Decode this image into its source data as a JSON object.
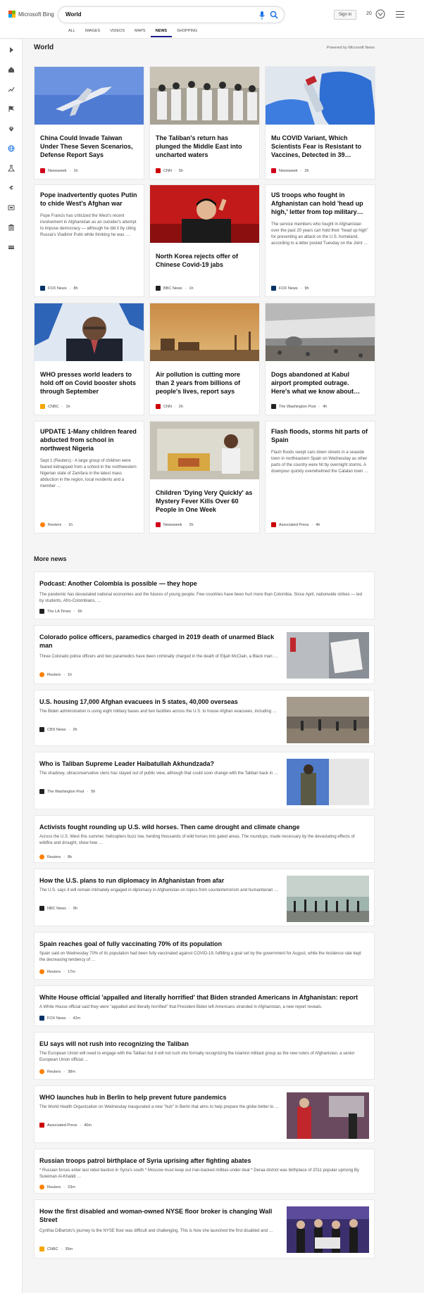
{
  "header": {
    "brand": "Microsoft Bing",
    "query": "World",
    "signin": "Sign in",
    "points": "20",
    "tabs": [
      "ALL",
      "IMAGES",
      "VIDEOS",
      "MAPS",
      "NEWS",
      "SHOPPING"
    ],
    "active_tab": "NEWS"
  },
  "section": {
    "title": "World",
    "powered_by": "Powered by Microsoft News"
  },
  "cards": [
    {
      "title": "China Could Invade Taiwan Under These Seven Scenarios, Defense Report Says",
      "snippet": "",
      "source": "Newsweek",
      "time": "1h",
      "src_color": "#d0021b"
    },
    {
      "title": "The Taliban's return has plunged the Middle East into uncharted waters",
      "snippet": "",
      "source": "CNN",
      "time": "5h",
      "src_color": "#cc0000"
    },
    {
      "title": "Mu COVID Variant, Which Scientists Fear is Resistant to Vaccines, Detected in 39…",
      "snippet": "",
      "source": "Newsweek",
      "time": "2h",
      "src_color": "#d0021b"
    },
    {
      "title": "Pope inadvertently quotes Putin to chide West's Afghan war",
      "snippet": "Pope Francis has criticized the West's recent involvement in Afghanistan as an outsider's attempt to impose democracy — although he did it by citing Russia's Vladimir Putin while thinking he was …",
      "source": "FOX News",
      "time": "8h",
      "src_color": "#003366"
    },
    {
      "title": "North Korea rejects offer of Chinese Covid-19 jabs",
      "snippet": "",
      "source": "BBC News",
      "time": "1h",
      "src_color": "#222222"
    },
    {
      "title": "US troops who fought in Afghanistan can hold 'head up high,' letter from top military…",
      "snippet": "The service members who fought in Afghanistan over the past 20 years can hold their \"head up high\" for preventing an attack on the U.S. homeland, according to a letter posted Tuesday on the Joint …",
      "source": "FOX News",
      "time": "9h",
      "src_color": "#003366"
    },
    {
      "title": "WHO presses world leaders to hold off on Covid booster shots through September",
      "snippet": "",
      "source": "CNBC",
      "time": "1h",
      "src_color": "#f7a600"
    },
    {
      "title": "Air pollution is cutting more than 2 years from billions of people's lives, report says",
      "snippet": "",
      "source": "CNN",
      "time": "2h",
      "src_color": "#cc0000"
    },
    {
      "title": "Dogs abandoned at Kabul airport prompted outrage. Here's what we know about…",
      "snippet": "",
      "source": "The Washington Post",
      "time": "4h",
      "src_color": "#222222"
    },
    {
      "title": "UPDATE 1-Many children feared abducted from school in northwest Nigeria",
      "snippet": "Sept 1 (Reuters) - A large group of children were feared kidnapped from a school in the northwestern Nigerian state of Zamfara in the latest mass abduction in the region, local residents and a member …",
      "source": "Reuters",
      "time": "1h",
      "src_color": "#ff8000"
    },
    {
      "title": "Children 'Dying Very Quickly' as Mystery Fever Kills Over 60 People in One Week",
      "snippet": "",
      "source": "Newsweek",
      "time": "2h",
      "src_color": "#d0021b"
    },
    {
      "title": "Flash floods, storms hit parts of Spain",
      "snippet": "Flash floods swept cars down streets in a seaside town in northeastern Spain on Wednesday as other parts of the country were hit by overnight storms. A downpour quickly overwhelmed the Catalan town …",
      "source": "Associated Press",
      "time": "4h",
      "src_color": "#cc0000"
    }
  ],
  "more": {
    "title": "More news",
    "items": [
      {
        "title": "Podcast: Another Colombia is possible — they hope",
        "snippet": "The pandemic has devastated national economies and the futures of young people. Few countries have been hurt more than Colombia. Since April, nationwide strikes — led by students, Afro-Colombians, …",
        "source": "The LA Times",
        "time": "6h",
        "src_color": "#222222"
      },
      {
        "title": "Colorado police officers, paramedics charged in 2019 death of unarmed Black man",
        "snippet": "Three Colorado police officers and two paramedics have been criminally charged in the death of Elijah McClain, a Black man …",
        "source": "Reuters",
        "time": "1h",
        "src_color": "#ff8000"
      },
      {
        "title": "U.S. housing 17,000 Afghan evacuees in 5 states, 40,000 overseas",
        "snippet": "The Biden administration is using eight military bases and two facilities across the U.S. to house Afghan evacuees, including …",
        "source": "CBS News",
        "time": "2h",
        "src_color": "#222222"
      },
      {
        "title": "Who is Taliban Supreme Leader Haibatullah Akhundzada?",
        "snippet": "The shadowy, ultraconservative cleric has stayed out of public view, although that could soon change with the Taliban back in …",
        "source": "The Washington Post",
        "time": "5h",
        "src_color": "#222222"
      },
      {
        "title": "Activists fought rounding up U.S. wild horses. Then came drought and climate change",
        "snippet": "Across the U.S. West this summer, helicopters buzz low, herding thousands of wild horses into gated areas. The roundups, made necessary by the devastating effects of wildfire and drought, show how …",
        "source": "Reuters",
        "time": "8h",
        "src_color": "#ff8000"
      },
      {
        "title": "How the U.S. plans to run diplomacy in Afghanistan from afar",
        "snippet": "The U.S. says it will remain intimately engaged in diplomacy in Afghanistan on topics from counterterrorism and humanitarian …",
        "source": "NBC News",
        "time": "9h",
        "src_color": "#222222"
      },
      {
        "title": "Spain reaches goal of fully vaccinating 70% of its population",
        "snippet": "Spain said on Wednesday 70% of its population had been fully vaccinated against COVID-19, fulfilling a goal set by the government for August, while the incidence rate kept the decreasing tendency of …",
        "source": "Reuters",
        "time": "17m",
        "src_color": "#ff8000"
      },
      {
        "title": "White House official 'appalled and literally horrified' that Biden stranded Americans in Afghanistan: report",
        "snippet": "A White House official said they were \"appalled and literally horrified\" that President Biden left Americans stranded in Afghanistan, a new report reveals.",
        "source": "FOX News",
        "time": "42m",
        "src_color": "#003366"
      },
      {
        "title": "EU says will not rush into recognizing the Taliban",
        "snippet": "The European Union will need to engage with the Taliban but it will not rush into formally recognizing the Islamist militant group as the new rulers of Afghanistan, a senior European Union official …",
        "source": "Reuters",
        "time": "38m",
        "src_color": "#ff8000"
      },
      {
        "title": "WHO launches hub in Berlin to help prevent future pandemics",
        "snippet": "The World Health Organization on Wednesday inaugurated a new \"hub\" in Berlin that aims to help prepare the globe better to …",
        "source": "Associated Press",
        "time": "40m",
        "src_color": "#cc0000"
      },
      {
        "title": "Russian troops patrol birthplace of Syria uprising after fighting abates",
        "snippet": "* Russian forces enter last rebel bastion in Syria's south * Moscow must keep out Iran-backed militias under deal * Deraa district was birthplace of 2011 popular uprising By Suleiman Al-Khalidi …",
        "source": "Reuters",
        "time": "23m",
        "src_color": "#ff8000"
      },
      {
        "title": "How the first disabled and woman-owned NYSE floor broker is changing Wall Street",
        "snippet": "Cynthia DiBartolo's journey to the NYSE floor was difficult and challenging. This is how she launched the first disabled and …",
        "source": "CNBC",
        "time": "35m",
        "src_color": "#f7a600"
      }
    ]
  }
}
